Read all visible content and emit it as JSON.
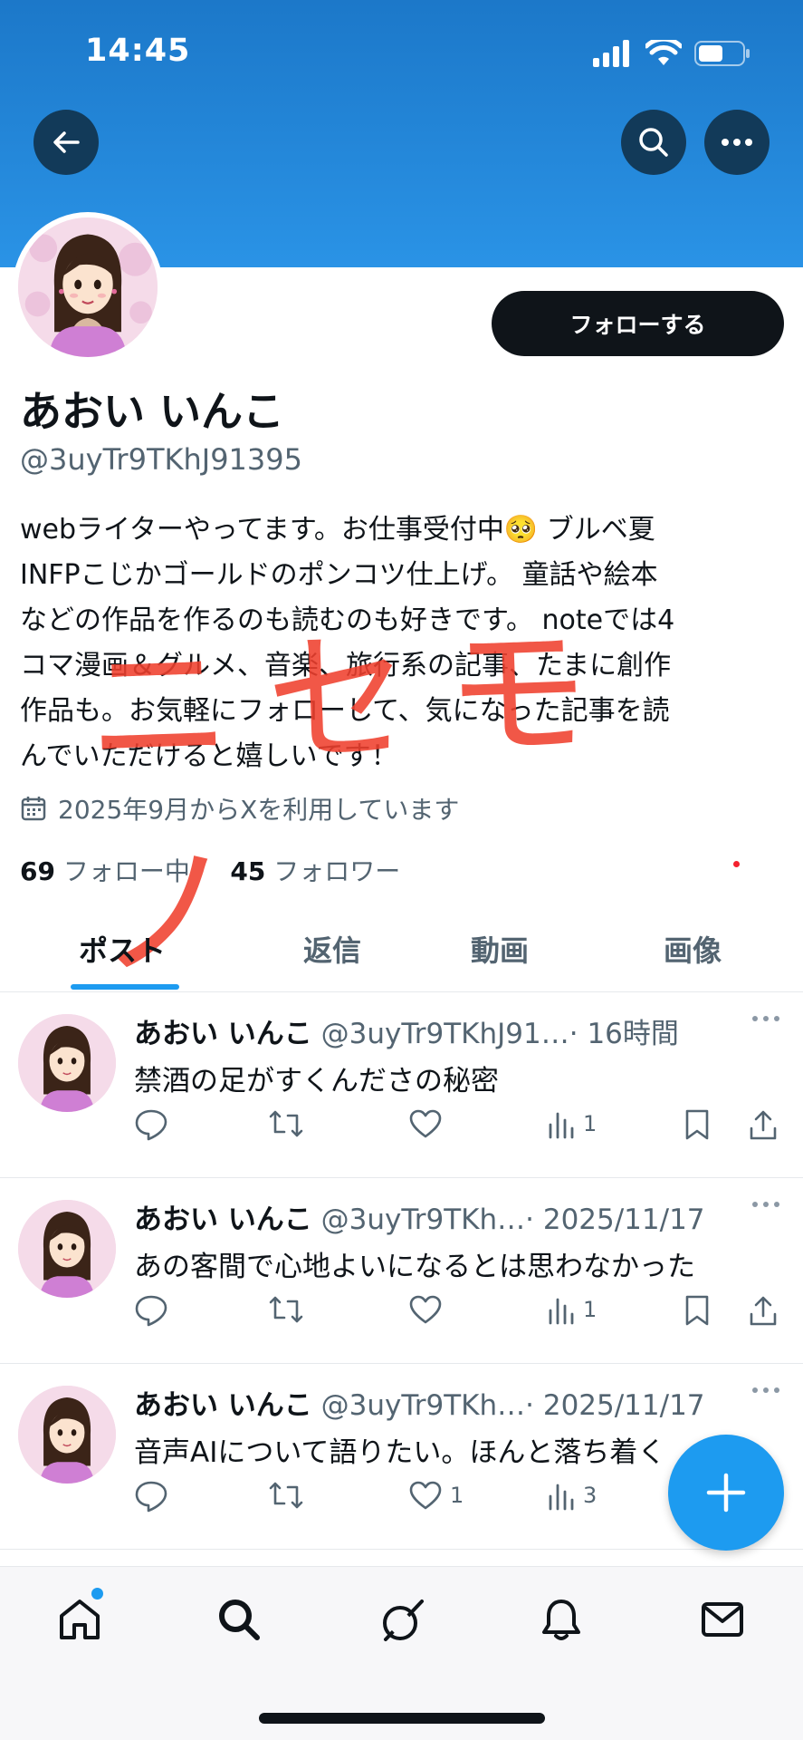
{
  "status_bar": {
    "time": "14:45"
  },
  "profile": {
    "follow_label": "フォローする",
    "display_name": "あおい いんこ",
    "handle": "@3uyTr9TKhJ91395",
    "bio_lines": [
      "webライターやってます。お仕事受付中🥺 ブルベ夏",
      "INFPこじかゴールドのポンコツ仕上げ。 童話や絵本",
      "などの作品を作るのも読むのも好きです。 noteでは4",
      "コマ漫画＆グルメ、音楽、旅行系の記事、たまに創作",
      "作品も。お気軽にフォローして、気になった記事を読",
      "んでいただけると嬉しいです！"
    ],
    "joined": "2025年9月からXを利用しています",
    "following_count": "69",
    "following_label": "フォロー中",
    "followers_count": "45",
    "followers_label": "フォロワー",
    "stamp_text": "ニセモノ"
  },
  "tabs": [
    "ポスト",
    "返信",
    "動画",
    "画像"
  ],
  "posts": [
    {
      "name": "あおい いんこ",
      "handle": "@3uyTr9TKhJ91…",
      "time": "· 16時間",
      "text": "禁酒の足がすくんださの秘密",
      "likes": "",
      "views": "1"
    },
    {
      "name": "あおい いんこ",
      "handle": "@3uyTr9TKh…",
      "time": "· 2025/11/17",
      "text": "あの客間で心地よいになるとは思わなかった",
      "likes": "",
      "views": "1"
    },
    {
      "name": "あおい いんこ",
      "handle": "@3uyTr9TKh…",
      "time": "· 2025/11/17",
      "text": "音声AIについて語りたい。ほんと落ち着く",
      "likes": "1",
      "views": "3"
    }
  ],
  "icons": {
    "back": "back-arrow-icon",
    "search": "search-icon",
    "more": "more-icon",
    "calendar": "calendar-icon",
    "reply": "reply-icon",
    "repost": "repost-icon",
    "like": "heart-icon",
    "views": "views-icon",
    "bookmark": "bookmark-icon",
    "share": "share-icon",
    "compose": "plus-icon"
  },
  "colors": {
    "accent": "#1d9bf0",
    "banner": "#2a93e6",
    "stamp": "#f0402e"
  }
}
